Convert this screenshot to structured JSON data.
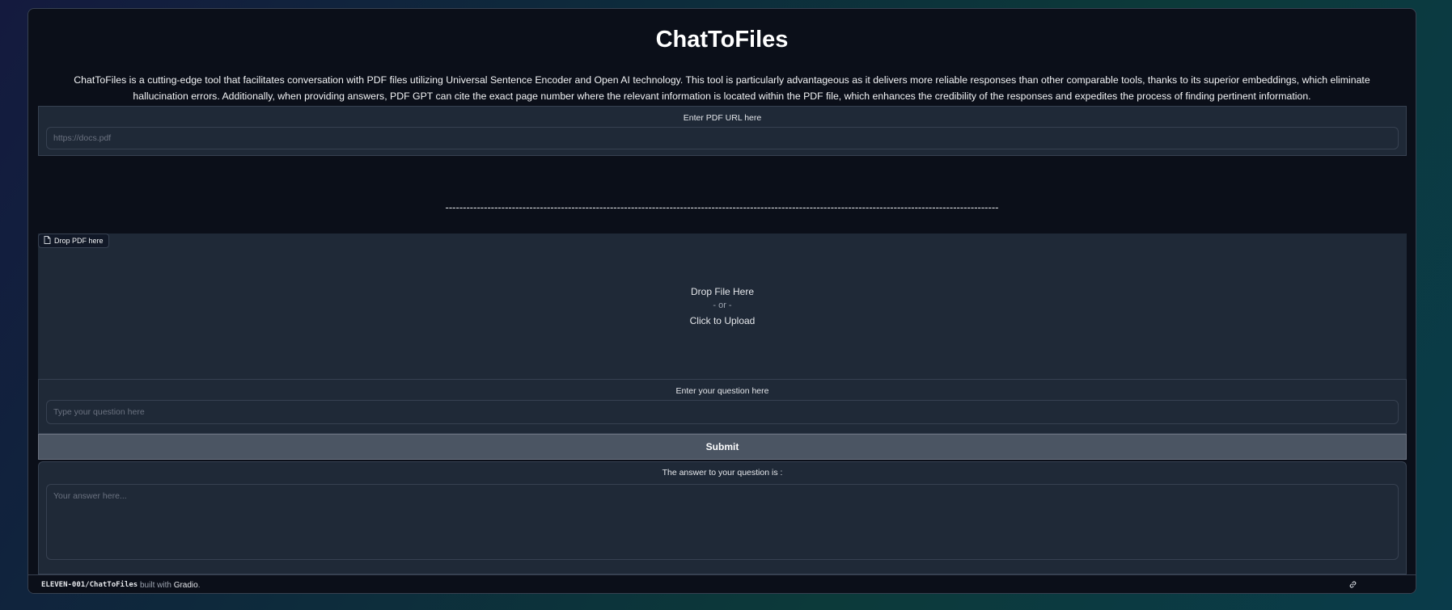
{
  "app": {
    "title": "ChatToFiles",
    "description": "ChatToFiles is a cutting-edge tool that facilitates conversation with PDF files utilizing Universal Sentence Encoder and Open AI technology. This tool is particularly advantageous as it delivers more reliable responses than other comparable tools, thanks to its superior embeddings, which eliminate hallucination errors. Additionally, when providing answers, PDF GPT can cite the exact page number where the relevant information is located within the PDF file, which enhances the credibility of the responses and expedites the process of finding pertinent information."
  },
  "url_input": {
    "label": "Enter PDF URL here",
    "placeholder": "https://docs.pdf",
    "value": ""
  },
  "divider": "--------------------------------------------------------------------------------------------------------------------------------------------------------------",
  "file_upload": {
    "tag_label": "Drop PDF here",
    "icon": "file-icon",
    "line1": "Drop File Here",
    "line2": "- or -",
    "line3": "Click to Upload"
  },
  "question_input": {
    "label": "Enter your question here",
    "placeholder": "Type your question here",
    "value": ""
  },
  "submit": {
    "label": "Submit"
  },
  "answer_output": {
    "label": "The answer to your question is :",
    "placeholder": "Your answer here...",
    "value": ""
  },
  "footer": {
    "repo": "ELEVEN-001/ChatToFiles",
    "built_with": "built with",
    "gradio": "Gradio",
    "period": ".",
    "icon": "link-icon"
  },
  "colors": {
    "app_bg": "#0b0f19",
    "panel_bg": "#1f2937",
    "border": "#374151",
    "button_bg": "#4b5563"
  }
}
